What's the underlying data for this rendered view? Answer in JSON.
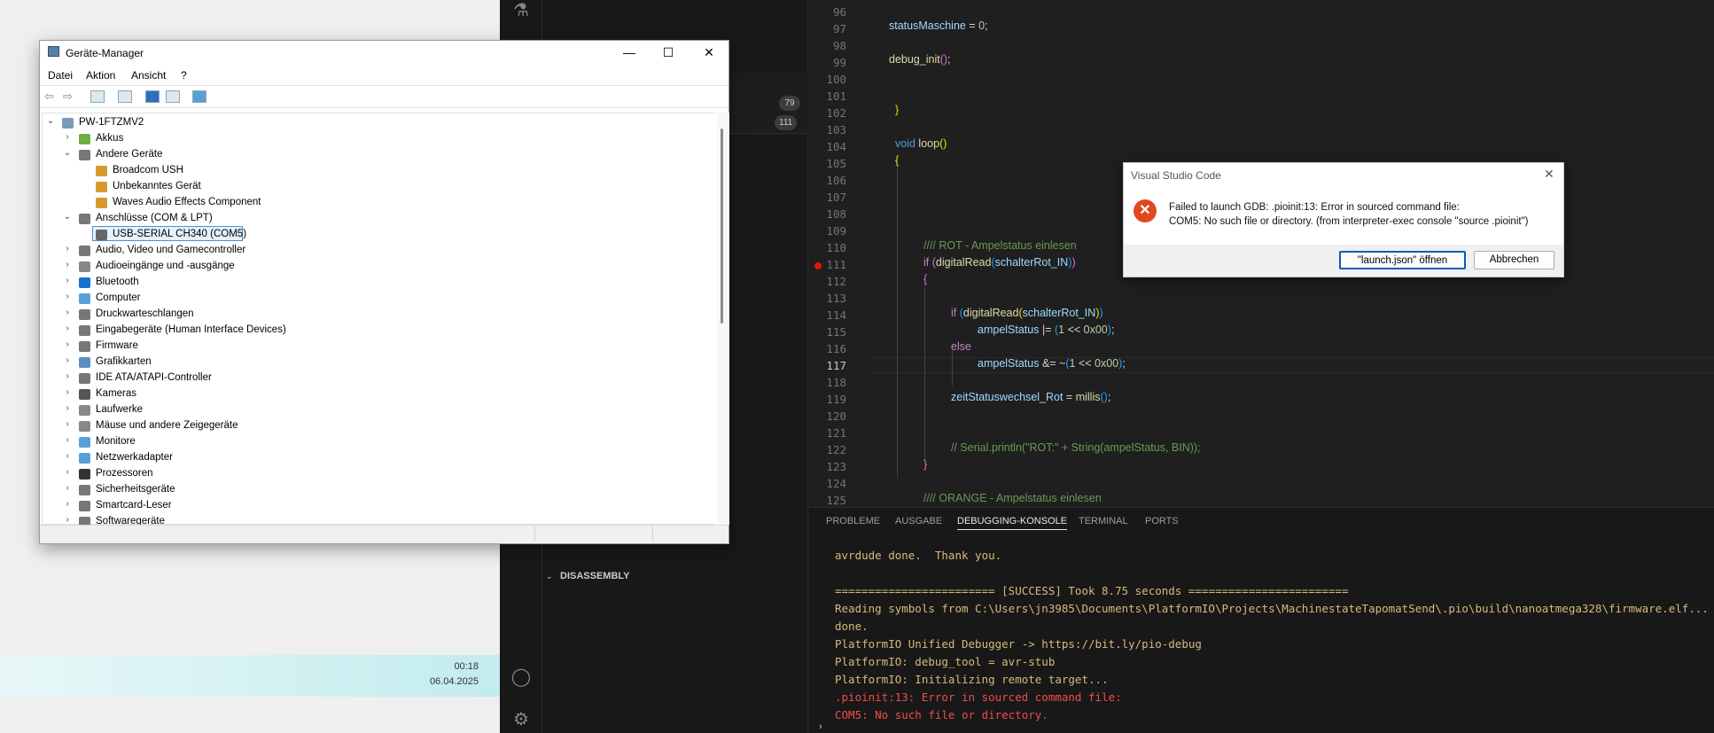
{
  "taskbar": {
    "time": "00:18",
    "date": "06.04.2025"
  },
  "sidebar": {
    "badges": [
      "79",
      "111"
    ],
    "disassembly_label": "DISASSEMBLY"
  },
  "editor": {
    "line_numbers": [
      "96",
      "97",
      "98",
      "99",
      "100",
      "101",
      "102",
      "103",
      "104",
      "105",
      "106",
      "107",
      "108",
      "109",
      "110",
      "111",
      "112",
      "113",
      "114",
      "115",
      "116",
      "117",
      "118",
      "119",
      "120",
      "121",
      "122",
      "123",
      "124",
      "125"
    ]
  },
  "panel": {
    "tabs": [
      "PROBLEME",
      "AUSGABE",
      "DEBUGGING-KONSOLE",
      "TERMINAL",
      "PORTS"
    ],
    "output": [
      "avrdude done.  Thank you.",
      "",
      "======================== [SUCCESS] Took 8.75 seconds ========================",
      "Reading symbols from C:\\Users\\jn3985\\Documents\\PlatformIO\\Projects\\MachinestateTapomatSend\\.pio\\build\\nanoatmega328\\firmware.elf...",
      "done.",
      "PlatformIO Unified Debugger -> https://bit.ly/pio-debug",
      "PlatformIO: debug_tool = avr-stub",
      "PlatformIO: Initializing remote target...",
      ".pioinit:13: Error in sourced command file:",
      "COM5: No such file or directory."
    ]
  },
  "dialog": {
    "title": "Visual Studio Code",
    "message_line1": "Failed to launch GDB: .pioinit:13: Error in sourced command file:",
    "message_line2": "COM5: No such file or directory. (from interpreter-exec console \"source .pioinit\")",
    "primary_button": "\"launch.json\" öffnen",
    "cancel_button": "Abbrechen"
  },
  "device_manager": {
    "title": "Geräte-Manager",
    "menu": [
      "Datei",
      "Aktion",
      "Ansicht",
      "?"
    ],
    "root": "PW-1FTZMV2",
    "tree": [
      "Akkus",
      "Andere Geräte",
      "Broadcom USH",
      "Unbekanntes Gerät",
      "Waves Audio Effects Component",
      "Anschlüsse (COM & LPT)",
      "USB-SERIAL CH340 (COM5)",
      "Audio, Video und Gamecontroller",
      "Audioeingänge und -ausgänge",
      "Bluetooth",
      "Computer",
      "Druckwarteschlangen",
      "Eingabegeräte (Human Interface Devices)",
      "Firmware",
      "Grafikkarten",
      "IDE ATA/ATAPI-Controller",
      "Kameras",
      "Laufwerke",
      "Mäuse und andere Zeigegeräte",
      "Monitore",
      "Netzwerkadapter",
      "Prozessoren",
      "Sicherheitsgeräte",
      "Smartcard-Leser",
      "Softwaregeräte"
    ]
  }
}
